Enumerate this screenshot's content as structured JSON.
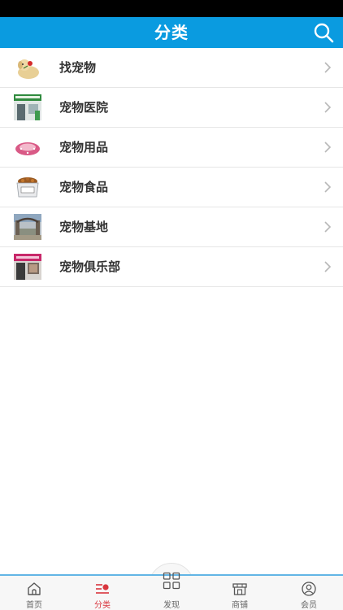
{
  "header": {
    "title": "分类",
    "search_icon": "search-icon"
  },
  "categories": [
    {
      "label": "找宠物",
      "thumb": "dog-with-rose-thumbnail"
    },
    {
      "label": "宠物医院",
      "thumb": "pet-hospital-storefront-thumbnail"
    },
    {
      "label": "宠物用品",
      "thumb": "pink-pet-bed-thumbnail"
    },
    {
      "label": "宠物食品",
      "thumb": "dog-food-bowl-thumbnail"
    },
    {
      "label": "宠物基地",
      "thumb": "pet-base-gate-thumbnail"
    },
    {
      "label": "宠物俱乐部",
      "thumb": "pet-club-storefront-thumbnail"
    }
  ],
  "tabbar": {
    "home": "首页",
    "category": "分类",
    "discover": "发现",
    "shops": "商铺",
    "member": "会员",
    "active": "分类"
  },
  "colors": {
    "header_bg": "#0a9be0",
    "active_tab": "#d9363e",
    "tab_border": "#62b5e5"
  }
}
